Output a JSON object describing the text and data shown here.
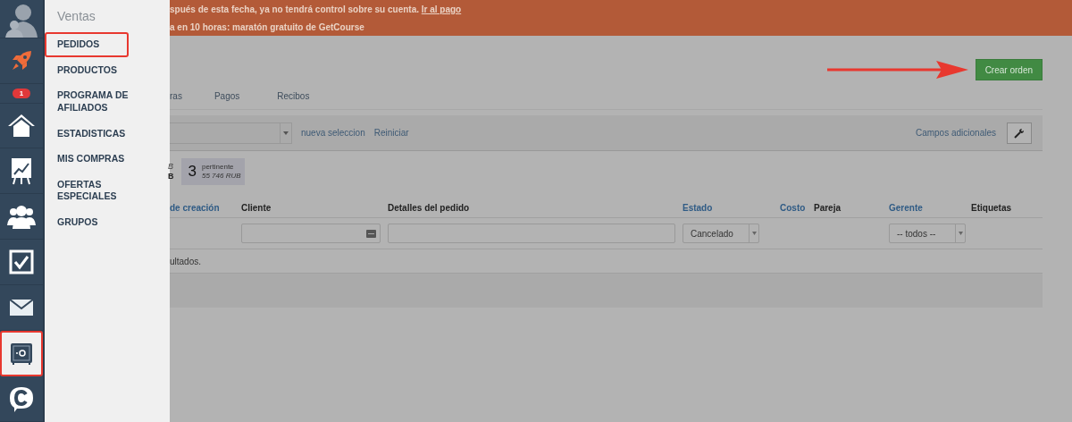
{
  "sidebar": {
    "items": [
      {
        "kind": "avatar",
        "highlighted": false
      },
      {
        "kind": "rocket",
        "highlighted": false
      },
      {
        "kind": "badge",
        "badge": "1",
        "highlighted": false
      },
      {
        "kind": "home",
        "highlighted": false
      },
      {
        "kind": "chart",
        "highlighted": false
      },
      {
        "kind": "people",
        "highlighted": false
      },
      {
        "kind": "check",
        "highlighted": false
      },
      {
        "kind": "mail",
        "highlighted": false
      },
      {
        "kind": "safe",
        "highlighted": true
      },
      {
        "kind": "chat",
        "highlighted": false
      }
    ]
  },
  "menu": {
    "title": "Ventas",
    "items": [
      {
        "label": "PEDIDOS",
        "highlighted": true
      },
      {
        "label": "PRODUCTOS",
        "highlighted": false
      },
      {
        "label": "PROGRAMA DE AFILIADOS",
        "highlighted": false
      },
      {
        "label": "ESTADISTICAS",
        "highlighted": false
      },
      {
        "label": "MIS COMPRAS",
        "highlighted": false
      },
      {
        "label": "OFERTAS ESPECIALES",
        "highlighted": false
      },
      {
        "label": "GRUPOS",
        "highlighted": false
      }
    ]
  },
  "banner": {
    "line_1": "spués de esta fecha, ya no tendrá control sobre su cuenta.",
    "link": "Ir al pago",
    "line_2": "a en 10 horas: maratón gratuito de GetCourse"
  },
  "create_button": "Crear orden",
  "tabs": [
    "ras",
    "Pagos",
    "Recibos"
  ],
  "filter_bar": {
    "links": [
      "nueva seleccion",
      "Reiniciar"
    ],
    "extra_fields": "Campos adicionales"
  },
  "stats": {
    "partial_1": "B",
    "partial_2": "B",
    "count": "3",
    "label": "pertinente",
    "amount": "55 746 RUB"
  },
  "table": {
    "columns": [
      {
        "label": "de creación",
        "sortable": true
      },
      {
        "label": "Cliente",
        "sortable": false
      },
      {
        "label": "Detalles del pedido",
        "sortable": false
      },
      {
        "label": "Estado",
        "sortable": true
      },
      {
        "label": "Costo",
        "sortable": true
      },
      {
        "label": "Pareja",
        "sortable": false
      },
      {
        "label": "Gerente",
        "sortable": true
      },
      {
        "label": "Etiquetas",
        "sortable": false
      }
    ],
    "filters": [
      {
        "kind": "none"
      },
      {
        "kind": "date"
      },
      {
        "kind": "text"
      },
      {
        "kind": "select",
        "value": "Cancelado"
      },
      {
        "kind": "none"
      },
      {
        "kind": "none"
      },
      {
        "kind": "select",
        "value": "-- todos --"
      },
      {
        "kind": "none"
      }
    ],
    "message": "ultados."
  }
}
